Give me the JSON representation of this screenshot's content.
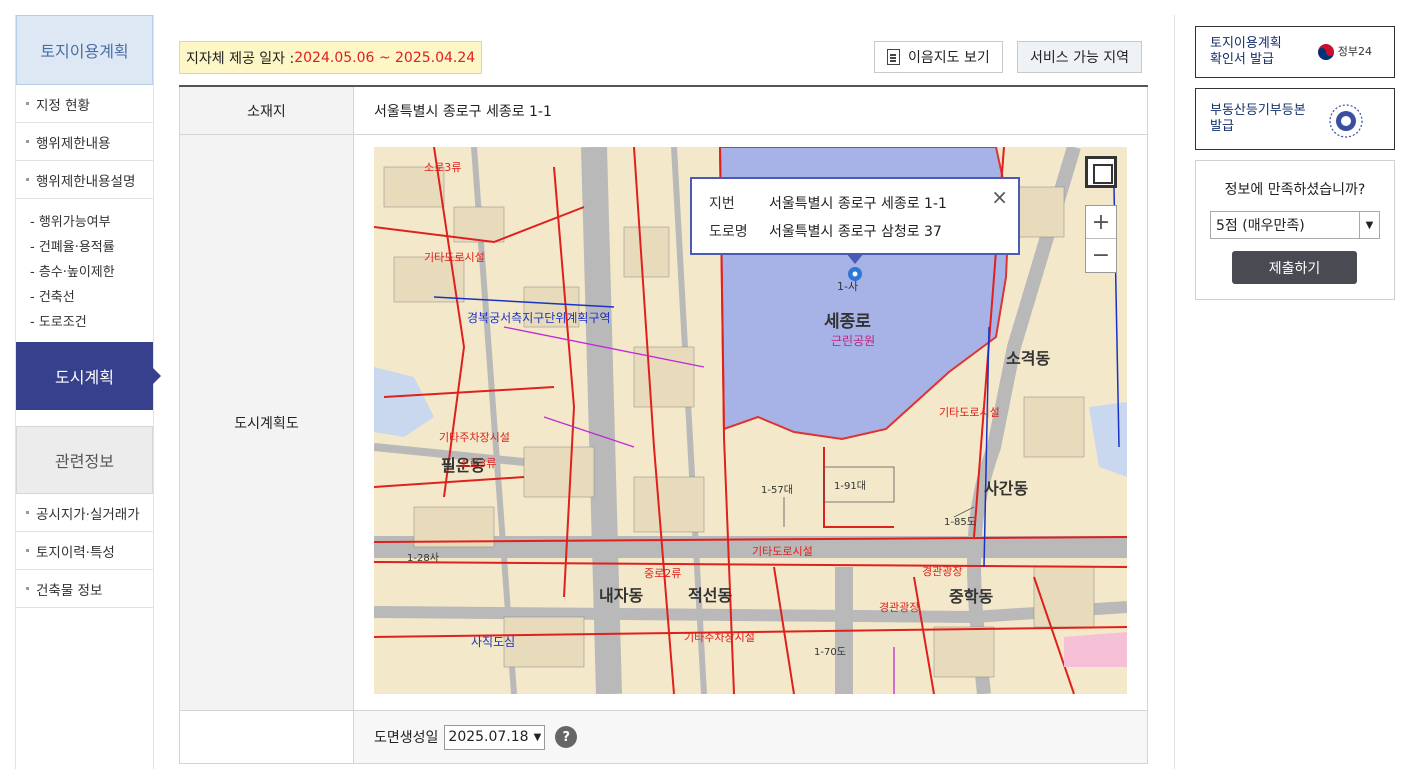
{
  "sidebar": {
    "header": "토지이용계획",
    "items_top": [
      "지정 현황",
      "행위제한내용",
      "행위제한내용설명"
    ],
    "sub_items": [
      "- 행위가능여부",
      "- 건폐율·용적률",
      "- 층수·높이제한",
      "- 건축선",
      "- 도로조건"
    ],
    "active": "도시계획",
    "related": "관련정보",
    "items_bottom": [
      "공시지가·실거래가",
      "토지이력·특성",
      "건축물 정보"
    ]
  },
  "main": {
    "period_label": "지자체 제공 일자 : ",
    "period_value": "2024.05.06 ~ 2025.04.24",
    "map_button": "이음지도 보기",
    "area_button": "서비스 가능 지역",
    "location_label": "소재지",
    "location_value": "서울특별시 종로구 세종로 1-1",
    "plan_label": "도시계획도",
    "date_label": "도면생성일",
    "date_value": "2025.07.18",
    "help": "?"
  },
  "map": {
    "popup": {
      "jibun_label": "지번",
      "jibun_value": "서울특별시 종로구 세종로 1-1",
      "road_label": "도로명",
      "road_value": "서울특별시 종로구 삼청로 37",
      "close": "×"
    },
    "zoom_in": "+",
    "zoom_out": "−",
    "labels": {
      "sejongro": "세종로",
      "park": "근린공원",
      "parcel": "1-사",
      "naeja": "내자동",
      "jeokseon": "적선동",
      "sagan": "사간동",
      "sogyeok": "소격동",
      "junghak": "중학동",
      "pirun": "필운동",
      "sajik": "사직도심",
      "gyeongbok": "경복궁서측지구단위계획구역",
      "road1": "기타도로시설",
      "road2": "소로3류",
      "road3": "중로2류",
      "road4": "기타주차장시설",
      "road5": "경관광장",
      "p1": "1-57대",
      "p2": "1-91대",
      "p3": "1-28사",
      "p4": "1-85도",
      "p5": "1-70도"
    }
  },
  "right": {
    "box1_line1": "토지이용계획",
    "box1_line2": "확인서 발급",
    "gov24": "정부24",
    "box2_line1": "부동산등기부등본",
    "box2_line2": "발급",
    "survey_question": "정보에 만족하셨습니까?",
    "survey_option": "5점 (매우만족)",
    "submit": "제출하기"
  },
  "colors": {
    "accent": "#36408c",
    "red": "#e0201c",
    "park": "#a7b3e6",
    "land": "#f3e8c9"
  }
}
